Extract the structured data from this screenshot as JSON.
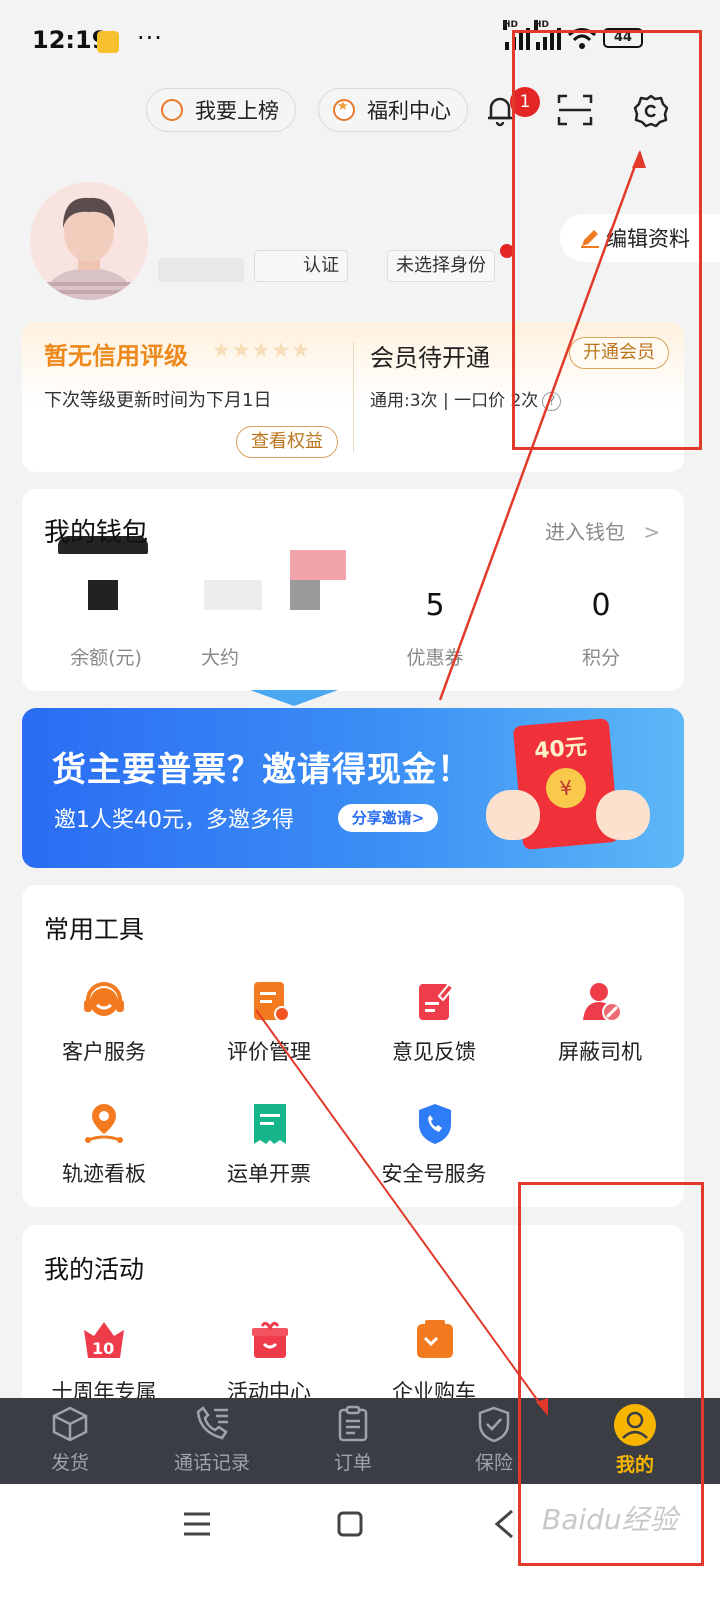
{
  "status_bar": {
    "time": "12:19",
    "more": "···",
    "hd1": "HD",
    "hd2": "HD",
    "battery": "44"
  },
  "header": {
    "ranking_label": "我要上榜",
    "welfare_label": "福利中心",
    "notification_count": "1"
  },
  "profile": {
    "tag_verify": "认证",
    "tag_identity": "未选择身份",
    "edit_label": "编辑资料"
  },
  "credit": {
    "title": "暂无信用评级",
    "stars": "★★★★★",
    "subtitle": "下次等级更新时间为下月1日",
    "link": "查看权益",
    "vip_title": "会员待开通",
    "vip_button": "开通会员",
    "vip_info": "通用:3次 | 一口价 2次",
    "vip_help": "?"
  },
  "wallet": {
    "title": "我的钱包",
    "enter": "进入钱包",
    "items": [
      {
        "value": "",
        "label": "余额(元)"
      },
      {
        "value": "",
        "label": "大约"
      },
      {
        "value": "5",
        "label": "优惠券"
      },
      {
        "value": "0",
        "label": "积分"
      }
    ]
  },
  "banner": {
    "title": "货主要普票？邀请得现金！",
    "subtitle": "邀1人奖40元，多邀多得",
    "button": "分享邀请>",
    "envelope": "40元",
    "coin": "¥"
  },
  "tools": {
    "title": "常用工具",
    "items": [
      {
        "label": "客户服务",
        "icon": "headset-icon"
      },
      {
        "label": "评价管理",
        "icon": "review-icon"
      },
      {
        "label": "意见反馈",
        "icon": "feedback-icon"
      },
      {
        "label": "屏蔽司机",
        "icon": "block-driver-icon"
      },
      {
        "label": "轨迹看板",
        "icon": "track-icon"
      },
      {
        "label": "运单开票",
        "icon": "invoice-icon"
      },
      {
        "label": "安全号服务",
        "icon": "secure-phone-icon"
      }
    ]
  },
  "activities": {
    "title": "我的活动",
    "items": [
      {
        "label": "十周年专属",
        "icon": "anniversary-icon"
      },
      {
        "label": "活动中心",
        "icon": "gift-icon"
      },
      {
        "label": "企业购车",
        "icon": "car-purchase-icon"
      }
    ]
  },
  "tabbar": {
    "items": [
      {
        "label": "发货"
      },
      {
        "label": "通话记录"
      },
      {
        "label": "订单"
      },
      {
        "label": "保险"
      },
      {
        "label": "我的"
      }
    ]
  },
  "watermark": "Baidu经验",
  "colors": {
    "accent": "#f7b500",
    "orange": "#ee8a1d",
    "annotation": "#e23a2a",
    "banner": "#2a6cf3"
  }
}
